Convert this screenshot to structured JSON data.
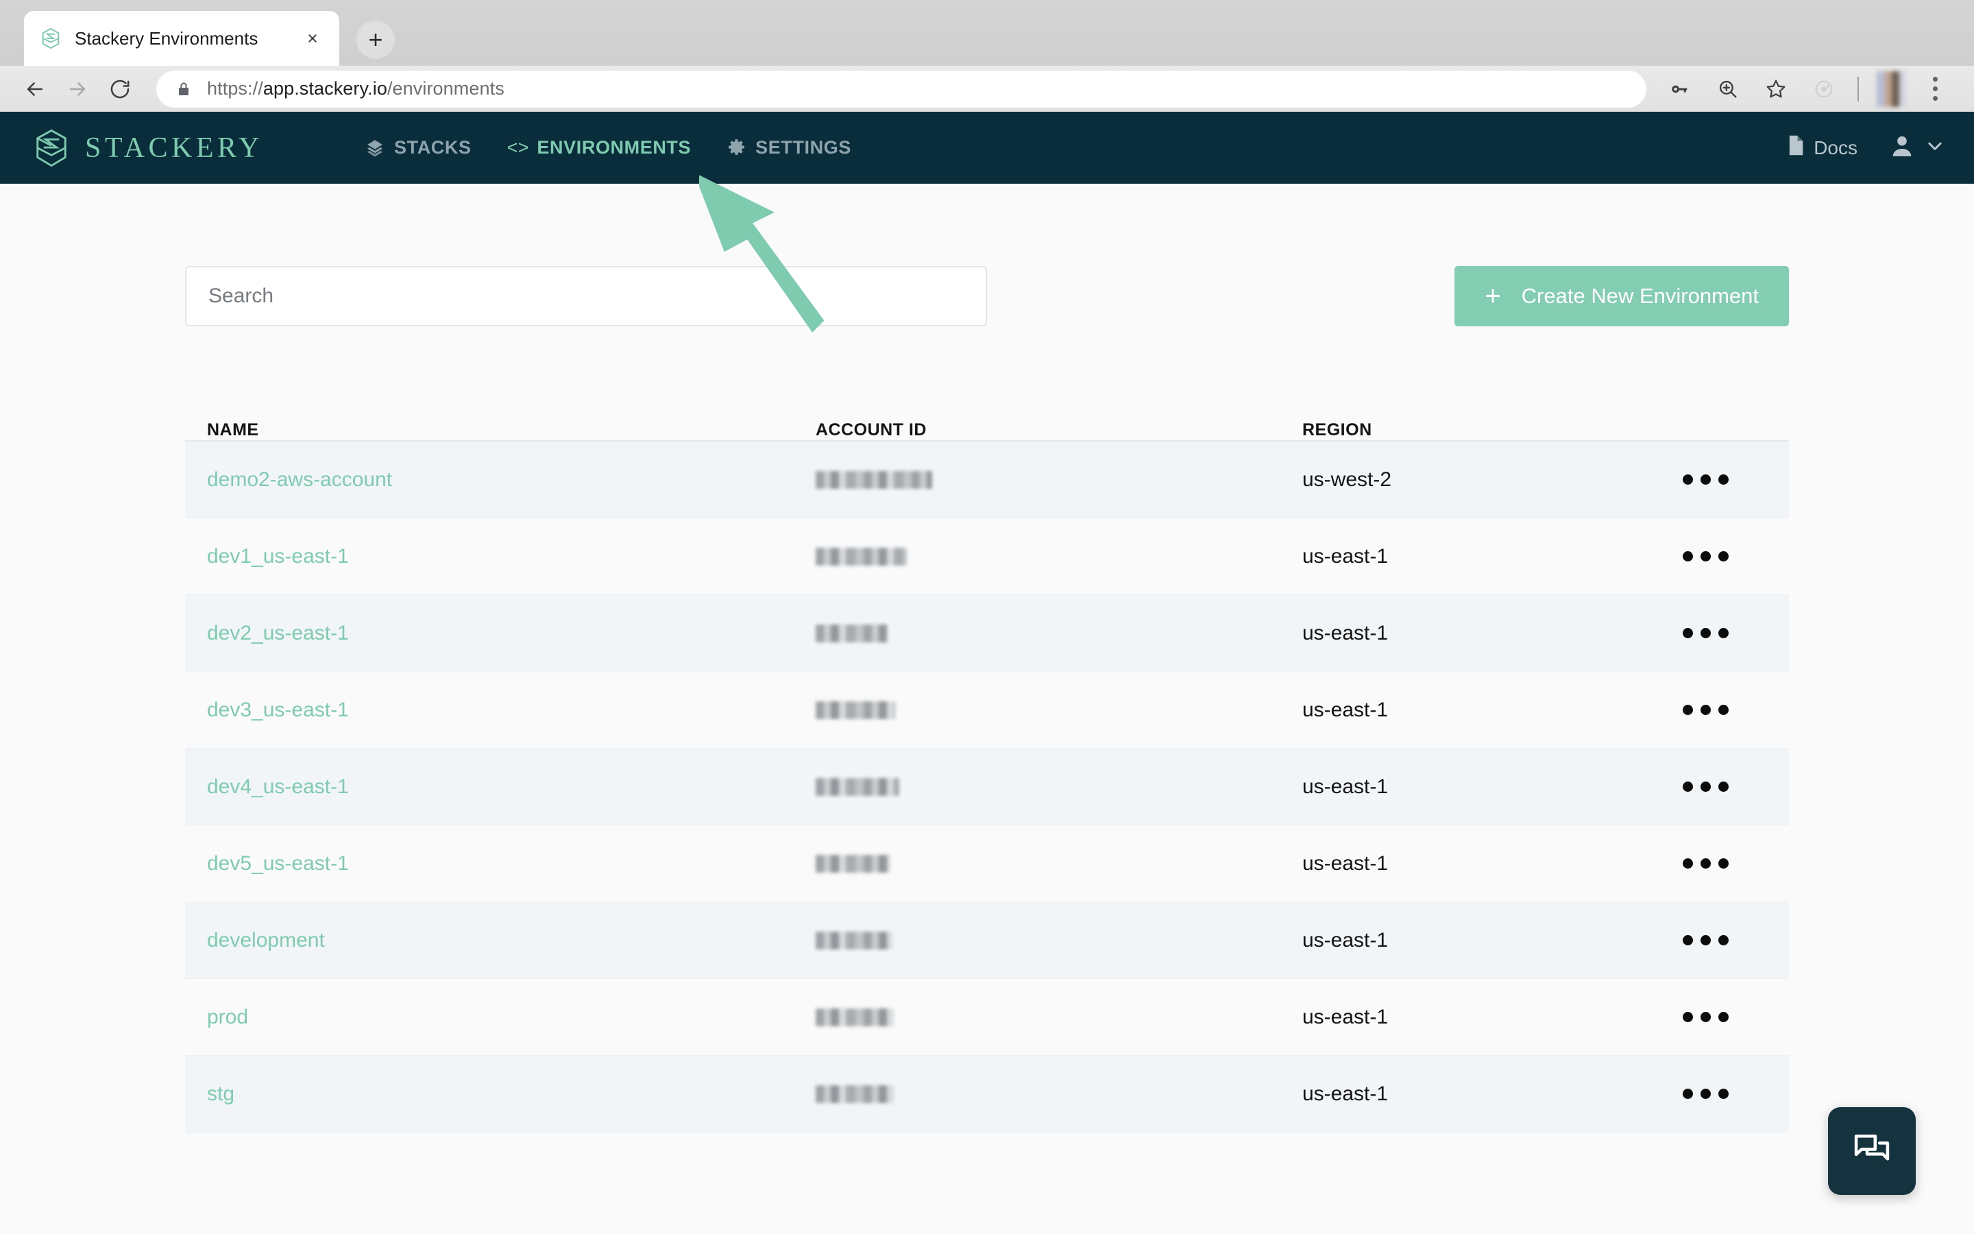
{
  "browser": {
    "tab": {
      "title": "Stackery Environments",
      "favicon": "stackery-logo-icon",
      "close": "×"
    },
    "new_tab_label": "+",
    "nav": {
      "back": "back-arrow-icon",
      "forward": "forward-arrow-icon",
      "reload": "reload-icon"
    },
    "omnibox": {
      "lock": "lock-icon",
      "scheme": "https://",
      "host": "app.stackery.io",
      "path": "/environments",
      "full_url": "https://app.stackery.io/environments"
    },
    "toolbar_icons": [
      "key-icon",
      "zoom-in-icon",
      "bookmark-star-icon",
      "extension-icon",
      "profile-avatar",
      "kebab-menu-icon"
    ]
  },
  "appnav": {
    "brand": {
      "text": "STACKERY",
      "mark": "stackery-cube-icon"
    },
    "links": [
      {
        "label": "STACKS",
        "icon": "layers-icon",
        "active": false
      },
      {
        "label": "ENVIRONMENTS",
        "icon": "code-brackets-icon",
        "active": true
      },
      {
        "label": "SETTINGS",
        "icon": "gear-icon",
        "active": false
      }
    ],
    "docs": {
      "label": "Docs",
      "icon": "document-icon"
    },
    "user": {
      "icon": "person-icon",
      "chevron": "chevron-down-icon"
    }
  },
  "toolbar": {
    "search": {
      "placeholder": "Search",
      "value": ""
    },
    "create_button": {
      "label": "Create New Environment",
      "icon": "plus-icon"
    }
  },
  "table": {
    "headers": [
      "NAME",
      "ACCOUNT ID",
      "REGION"
    ],
    "row_menu_icon": "ellipsis-horizontal-icon",
    "rows": [
      {
        "name": "demo2-aws-account",
        "account_id": "",
        "account_id_redacted": true,
        "region": "us-west-2"
      },
      {
        "name": "dev1_us-east-1",
        "account_id": "",
        "account_id_redacted": true,
        "region": "us-east-1"
      },
      {
        "name": "dev2_us-east-1",
        "account_id": "",
        "account_id_redacted": true,
        "region": "us-east-1"
      },
      {
        "name": "dev3_us-east-1",
        "account_id": "",
        "account_id_redacted": true,
        "region": "us-east-1"
      },
      {
        "name": "dev4_us-east-1",
        "account_id": "",
        "account_id_redacted": true,
        "region": "us-east-1"
      },
      {
        "name": "dev5_us-east-1",
        "account_id": "",
        "account_id_redacted": true,
        "region": "us-east-1"
      },
      {
        "name": "development",
        "account_id": "",
        "account_id_redacted": true,
        "region": "us-east-1"
      },
      {
        "name": "prod",
        "account_id": "",
        "account_id_redacted": true,
        "region": "us-east-1"
      },
      {
        "name": "stg",
        "account_id": "",
        "account_id_redacted": true,
        "region": "us-east-1"
      }
    ]
  },
  "annotation": {
    "arrow": "pointer-arrow-annotation",
    "target": "ENVIRONMENTS"
  },
  "chat": {
    "icon": "chat-bubbles-icon"
  },
  "colors": {
    "navbar_bg": "#092d3a",
    "accent_green": "#7ecbaf",
    "button_green": "#83ceb2",
    "page_bg": "#fafafa",
    "row_stripe": "#f2f5f7",
    "nav_inactive": "#8fa3ad",
    "chat_bg": "#15323f"
  }
}
